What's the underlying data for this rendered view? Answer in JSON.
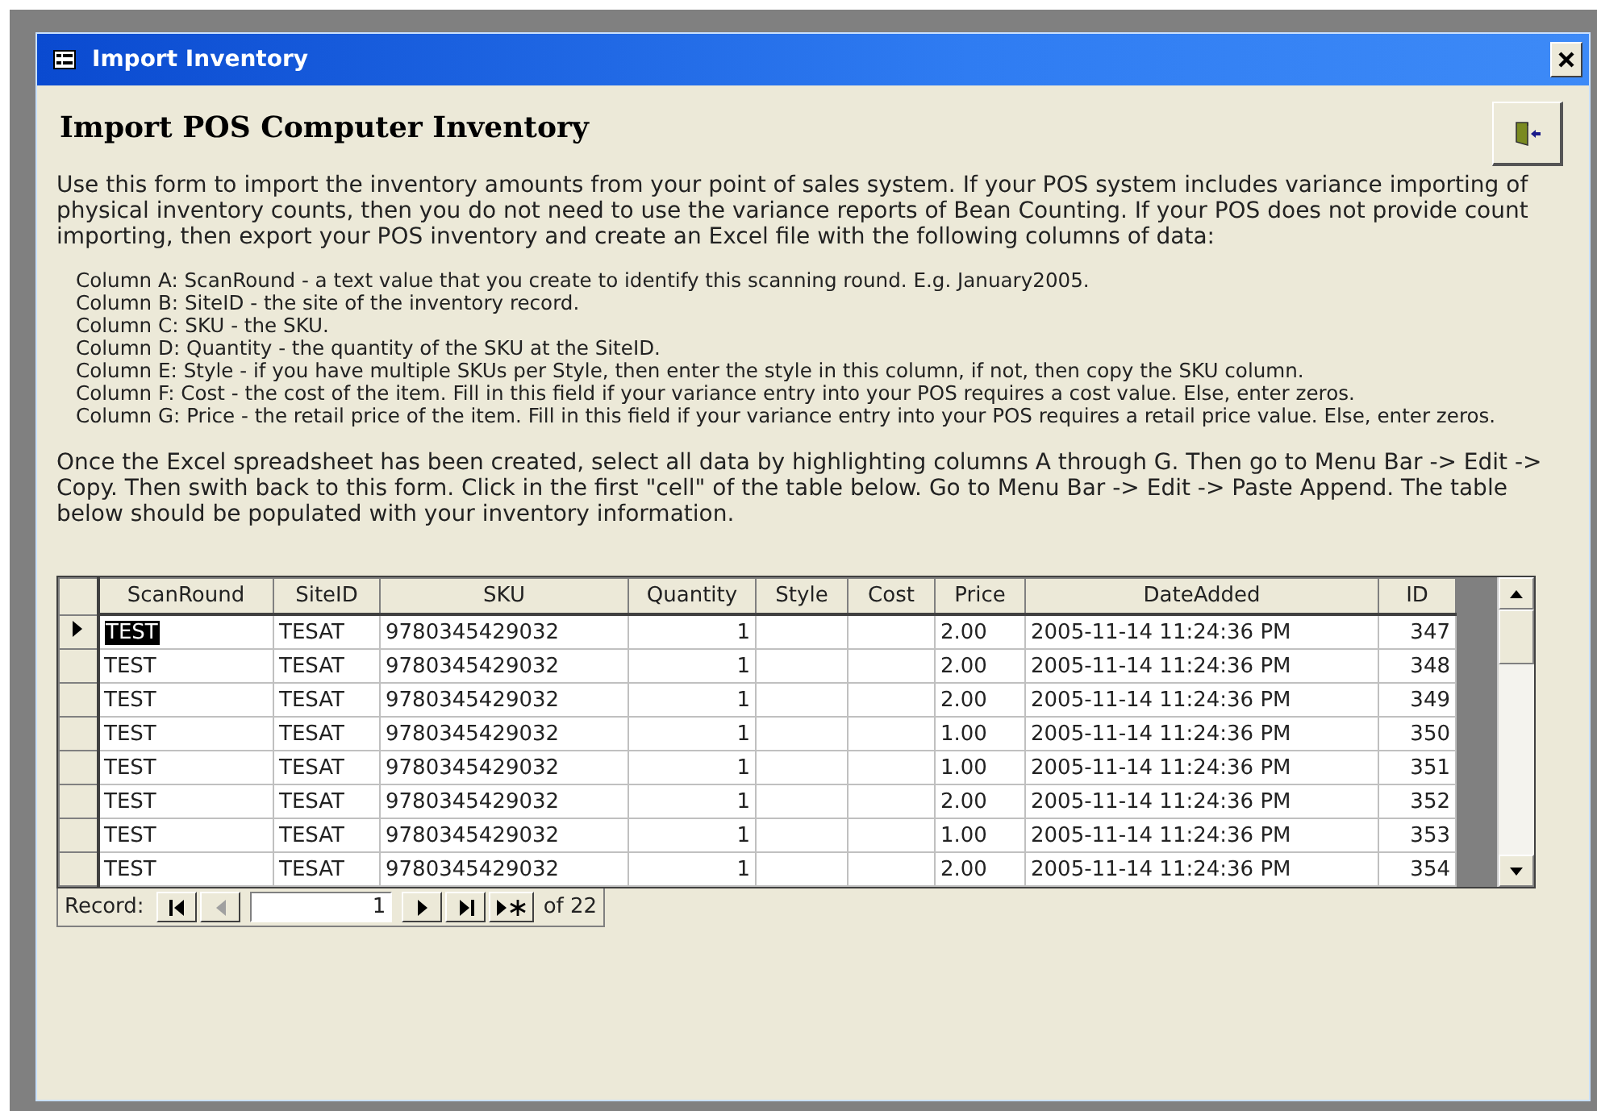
{
  "window": {
    "title": "Import Inventory"
  },
  "form": {
    "heading": "Import POS Computer Inventory",
    "intro": "Use this form to import the inventory amounts from your point of sales system.  If your POS system includes variance importing of physical inventory counts, then you do not need to use the variance reports of Bean Counting.  If your POS does not provide count importing, then export your POS inventory and create an Excel file with the following columns of data:",
    "column_notes": [
      "Column A: ScanRound - a text value that you create to identify this scanning round. E.g. January2005.",
      "Column B: SiteID - the site of the inventory record.",
      "Column C: SKU - the SKU.",
      "Column D: Quantity - the quantity of the SKU at the SiteID.",
      "Column E: Style - if you have multiple SKUs per Style, then enter the style in this column, if not, then copy the SKU column.",
      "Column F: Cost - the cost of the item. Fill in this field if your variance entry into your POS requires a cost value. Else, enter zeros.",
      "Column G: Price - the retail price of the item. Fill in this field if your variance entry into your POS requires a retail price value. Else, enter zeros."
    ],
    "instructions": "Once the Excel spreadsheet has been created, select all data by highlighting columns A through G. Then go to Menu Bar -> Edit -> Copy. Then swith back to this form. Click in the first \"cell\" of the table below.  Go to Menu Bar -> Edit -> Paste Append. The table below should be populated with your inventory information."
  },
  "table": {
    "columns": [
      {
        "label": "ScanRound"
      },
      {
        "label": "SiteID"
      },
      {
        "label": "SKU"
      },
      {
        "label": "Quantity"
      },
      {
        "label": "Style"
      },
      {
        "label": "Cost"
      },
      {
        "label": "Price"
      },
      {
        "label": "DateAdded"
      },
      {
        "label": "ID"
      }
    ],
    "rows": [
      {
        "selected": true,
        "cells": [
          "TEST",
          "TESAT",
          "9780345429032",
          "1",
          "",
          "",
          "2.00",
          "2005-11-14 11:24:36 PM",
          "347"
        ]
      },
      {
        "selected": false,
        "cells": [
          "TEST",
          "TESAT",
          "9780345429032",
          "1",
          "",
          "",
          "2.00",
          "2005-11-14 11:24:36 PM",
          "348"
        ]
      },
      {
        "selected": false,
        "cells": [
          "TEST",
          "TESAT",
          "9780345429032",
          "1",
          "",
          "",
          "2.00",
          "2005-11-14 11:24:36 PM",
          "349"
        ]
      },
      {
        "selected": false,
        "cells": [
          "TEST",
          "TESAT",
          "9780345429032",
          "1",
          "",
          "",
          "1.00",
          "2005-11-14 11:24:36 PM",
          "350"
        ]
      },
      {
        "selected": false,
        "cells": [
          "TEST",
          "TESAT",
          "9780345429032",
          "1",
          "",
          "",
          "1.00",
          "2005-11-14 11:24:36 PM",
          "351"
        ]
      },
      {
        "selected": false,
        "cells": [
          "TEST",
          "TESAT",
          "9780345429032",
          "1",
          "",
          "",
          "2.00",
          "2005-11-14 11:24:36 PM",
          "352"
        ]
      },
      {
        "selected": false,
        "cells": [
          "TEST",
          "TESAT",
          "9780345429032",
          "1",
          "",
          "",
          "1.00",
          "2005-11-14 11:24:36 PM",
          "353"
        ]
      },
      {
        "selected": false,
        "cells": [
          "TEST",
          "TESAT",
          "9780345429032",
          "1",
          "",
          "",
          "2.00",
          "2005-11-14 11:24:36 PM",
          "354"
        ]
      }
    ]
  },
  "navigator": {
    "label": "Record:",
    "current": "1",
    "total": "of 22",
    "buttons": [
      {
        "kind": "first",
        "disabled": false
      },
      {
        "kind": "prev",
        "disabled": true
      },
      {
        "kind": "next",
        "disabled": false
      },
      {
        "kind": "last",
        "disabled": false
      },
      {
        "kind": "new",
        "disabled": false
      }
    ]
  }
}
